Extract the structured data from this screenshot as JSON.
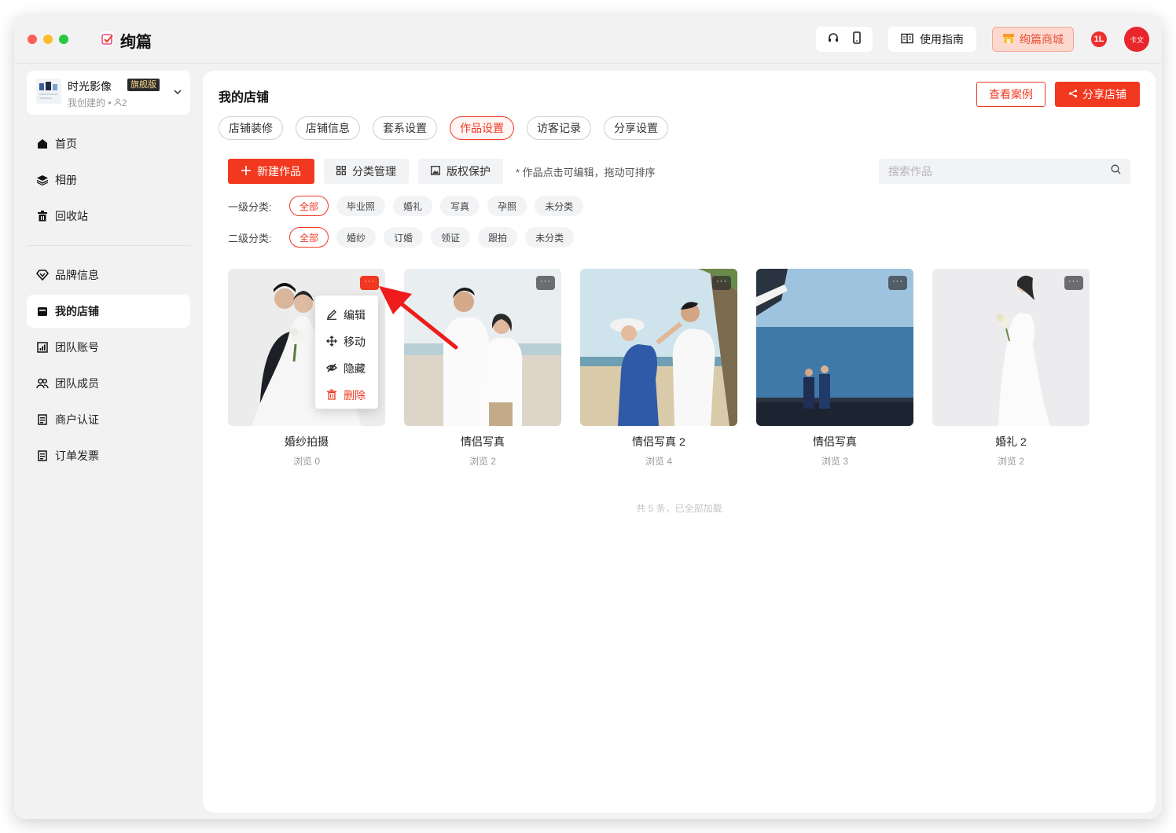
{
  "app": {
    "name": "绚篇",
    "colors": {
      "accent": "#f2381f",
      "accent_light": "#fff5f3"
    }
  },
  "titlebar": {
    "guide_label": "使用指南",
    "mall_label": "绚篇商城",
    "badge_text": "1L",
    "avatar_text": "卡文"
  },
  "store": {
    "name": "时光影像",
    "tag": "旗舰版",
    "sub": "我创建的 • ",
    "members": "2"
  },
  "sidebar": {
    "items": [
      {
        "label": "首页",
        "icon": "home-icon"
      },
      {
        "label": "相册",
        "icon": "layers-icon"
      },
      {
        "label": "回收站",
        "icon": "trash-icon"
      },
      {
        "label": "品牌信息",
        "icon": "brand-icon"
      },
      {
        "label": "我的店铺",
        "icon": "store-icon",
        "active": true
      },
      {
        "label": "团队账号",
        "icon": "team-account-icon"
      },
      {
        "label": "团队成员",
        "icon": "team-members-icon"
      },
      {
        "label": "商户认证",
        "icon": "certificate-icon"
      },
      {
        "label": "订单发票",
        "icon": "invoice-icon"
      }
    ]
  },
  "main": {
    "title": "我的店铺",
    "view_cases_label": "查看案例",
    "share_label": "分享店铺",
    "tabs": [
      "店铺装修",
      "店铺信息",
      "套系设置",
      "作品设置",
      "访客记录",
      "分享设置"
    ],
    "active_tab": "作品设置",
    "new_work_label": "新建作品",
    "category_manage_label": "分类管理",
    "copyright_label": "版权保护",
    "hint": "* 作品点击可编辑，拖动可排序",
    "search_placeholder": "搜索作品",
    "filter1": {
      "label": "一级分类:",
      "options": [
        "全部",
        "毕业照",
        "婚礼",
        "写真",
        "孕照",
        "未分类"
      ]
    },
    "filter2": {
      "label": "二级分类:",
      "options": [
        "全部",
        "婚纱",
        "订婚",
        "领证",
        "跟拍",
        "未分类"
      ]
    },
    "works": [
      {
        "title": "婚纱拍摄",
        "views": "浏览 0"
      },
      {
        "title": "情侣写真",
        "views": "浏览 2"
      },
      {
        "title": "情侣写真 2",
        "views": "浏览 4"
      },
      {
        "title": "情侣写真",
        "views": "浏览 3"
      },
      {
        "title": "婚礼 2",
        "views": "浏览 2"
      }
    ],
    "menu": {
      "edit": "编辑",
      "move": "移动",
      "hide": "隐藏",
      "delete": "删除"
    },
    "footer": "共 5 条，已全部加载"
  }
}
